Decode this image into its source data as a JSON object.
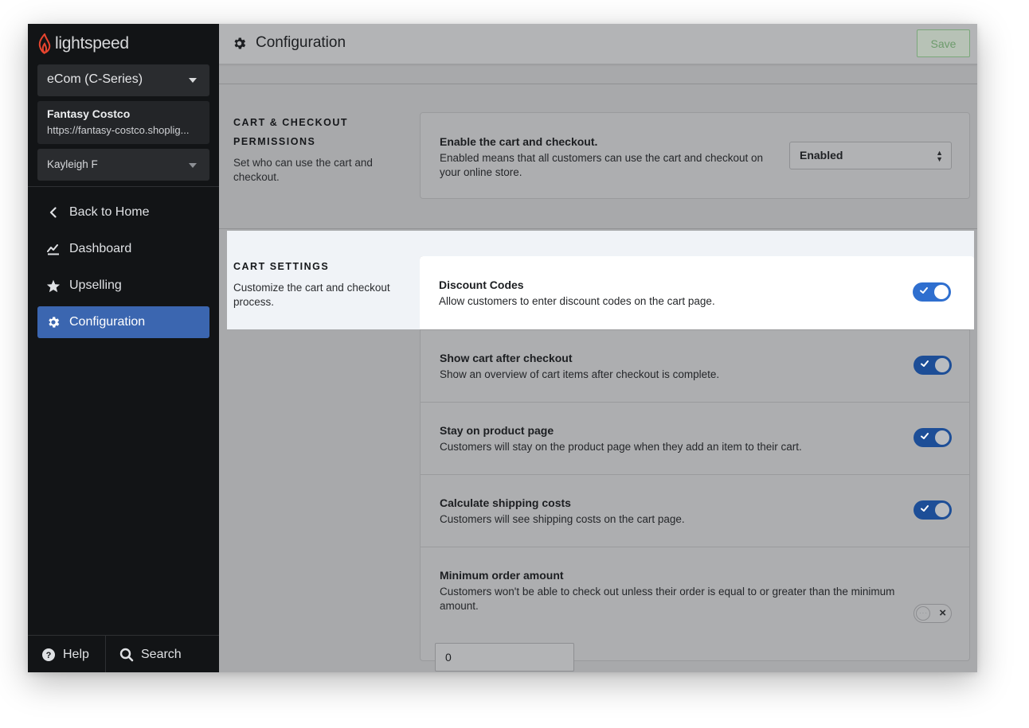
{
  "sidebar": {
    "logo_text": "lightspeed",
    "product_picker": "eCom (C-Series)",
    "store": {
      "name": "Fantasy Costco",
      "url": "https://fantasy-costco.shoplig..."
    },
    "user": "Kayleigh F",
    "nav": [
      {
        "label": "Back to Home",
        "icon": "chevron-left-icon"
      },
      {
        "label": "Dashboard",
        "icon": "chart-icon"
      },
      {
        "label": "Upselling",
        "icon": "star-icon"
      },
      {
        "label": "Configuration",
        "icon": "gear-icon",
        "active": true
      }
    ],
    "help_label": "Help",
    "search_label": "Search"
  },
  "header": {
    "title": "Configuration",
    "save_label": "Save"
  },
  "sections": {
    "permissions": {
      "title_line1": "CART & CHECKOUT",
      "title_line2": "PERMISSIONS",
      "description": "Set who can use the cart and checkout.",
      "row": {
        "title": "Enable the cart and checkout.",
        "description": "Enabled means that all customers can use the cart and checkout on your online store.",
        "select_value": "Enabled"
      }
    },
    "cart_settings": {
      "title": "CART SETTINGS",
      "description": "Customize the cart and checkout process.",
      "rows": [
        {
          "title": "Discount Codes",
          "description": "Allow customers to enter discount codes on the cart page.",
          "enabled": true
        },
        {
          "title": "Show cart after checkout",
          "description": "Show an overview of cart items after checkout is complete.",
          "enabled": true
        },
        {
          "title": "Stay on product page",
          "description": "Customers will stay on the product page when they add an item to their cart.",
          "enabled": true
        },
        {
          "title": "Calculate shipping costs",
          "description": "Customers will see shipping costs on the cart page.",
          "enabled": true
        },
        {
          "title": "Minimum order amount",
          "description": "Customers won't be able to check out unless their order is equal to or greater than the minimum amount.",
          "enabled": false,
          "amount_value": "0"
        }
      ]
    }
  },
  "colors": {
    "accent": "#3b66b0",
    "sidebar_bg": "#121416",
    "toggle_on": "#2f6fcf",
    "logo_red": "#e8452f"
  }
}
